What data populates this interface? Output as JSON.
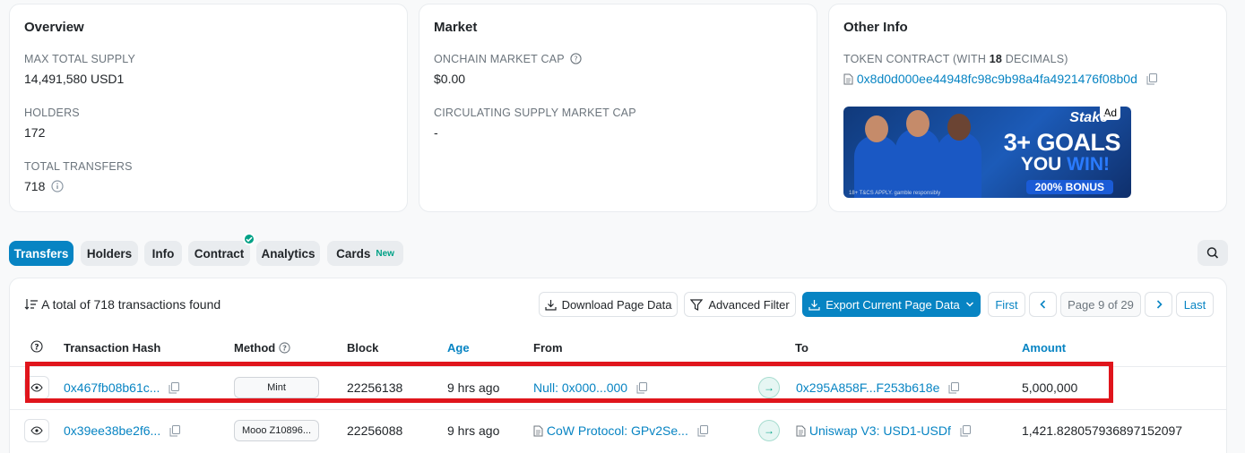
{
  "overview": {
    "title": "Overview",
    "max_supply_label": "MAX TOTAL SUPPLY",
    "max_supply_value": "14,491,580 USD1",
    "holders_label": "HOLDERS",
    "holders_value": "172",
    "transfers_label": "TOTAL TRANSFERS",
    "transfers_value": "718"
  },
  "market": {
    "title": "Market",
    "onchain_cap_label": "ONCHAIN MARKET CAP",
    "onchain_cap_value": "$0.00",
    "circ_cap_label": "CIRCULATING SUPPLY MARKET CAP",
    "circ_cap_value": "-"
  },
  "other_info": {
    "title": "Other Info",
    "contract_label_prefix": "TOKEN CONTRACT (WITH ",
    "contract_decimals": "18",
    "contract_label_suffix": " DECIMALS)",
    "contract_address": "0x8d0d000ee44948fc98c9b98a4fa4921476f08b0d",
    "ad": {
      "badge": "Ad",
      "brand": "Stake",
      "headline": "3+ GOALS",
      "you": "YOU ",
      "win": "WIN!",
      "bonus": "200% BONUS",
      "terms": "18+ T&CS APPLY. gamble responsibly"
    }
  },
  "tabs": [
    {
      "label": "Transfers"
    },
    {
      "label": "Holders"
    },
    {
      "label": "Info"
    },
    {
      "label": "Contract"
    },
    {
      "label": "Analytics"
    },
    {
      "label": "Cards",
      "badge": "New"
    }
  ],
  "toolbar": {
    "summary": "A total of 718 transactions found",
    "download": "Download Page Data",
    "advanced_filter": "Advanced Filter",
    "export": "Export Current Page Data",
    "first": "First",
    "page": "Page 9 of 29",
    "last": "Last"
  },
  "table": {
    "headers": {
      "hash": "Transaction Hash",
      "method": "Method",
      "block": "Block",
      "age": "Age",
      "from": "From",
      "to": "To",
      "amount": "Amount"
    },
    "rows": [
      {
        "hash": "0x467fb08b61c...",
        "method": "Mint",
        "block": "22256138",
        "age": "9 hrs ago",
        "from": "Null: 0x000...000",
        "to": "0x295A858F...F253b618e",
        "amount": "5,000,000"
      },
      {
        "hash": "0x39ee38be2f6...",
        "method": "Mooo Z10896...",
        "block": "22256088",
        "age": "9 hrs ago",
        "from": "CoW Protocol: GPv2Se...",
        "to": "Uniswap V3: USD1-USDf",
        "amount": "1,421.828057936897152097"
      }
    ]
  },
  "colors": {
    "accent": "#0784c3",
    "success": "#00a186",
    "highlight": "#e0151c"
  }
}
